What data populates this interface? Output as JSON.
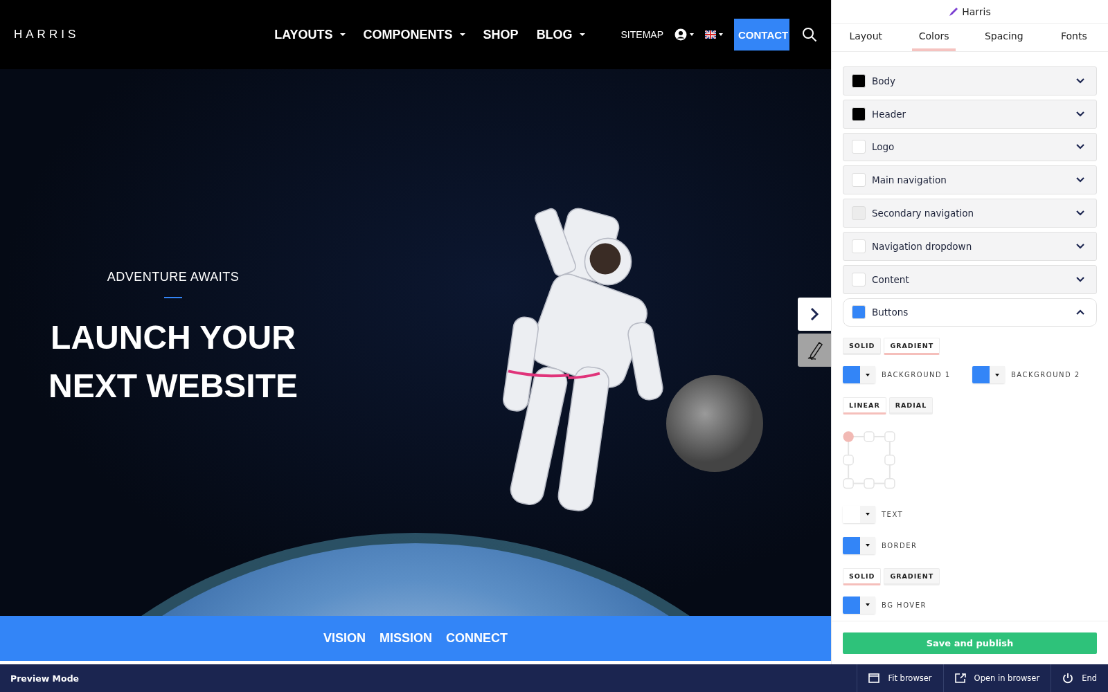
{
  "site_header": {
    "logo": "HARRIS",
    "nav": [
      {
        "label": "LAYOUTS",
        "dropdown": true
      },
      {
        "label": "COMPONENTS",
        "dropdown": true
      },
      {
        "label": "SHOP",
        "dropdown": false
      },
      {
        "label": "BLOG",
        "dropdown": true
      }
    ],
    "sitemap": "SITEMAP",
    "contact": "CONTACT"
  },
  "hero": {
    "eyebrow": "ADVENTURE AWAITS",
    "title_lines": [
      "LAUNCH YOUR",
      "NEXT WEBSITE"
    ]
  },
  "sub_nav": [
    "VISION",
    "MISSION",
    "CONNECT"
  ],
  "panel": {
    "title": "Harris",
    "tabs": [
      {
        "label": "Layout",
        "selected": false
      },
      {
        "label": "Colors",
        "selected": true
      },
      {
        "label": "Spacing",
        "selected": false
      },
      {
        "label": "Fonts",
        "selected": false
      }
    ],
    "sections": [
      {
        "label": "Body",
        "color": "#000000",
        "expanded": false
      },
      {
        "label": "Header",
        "color": "#000000",
        "expanded": false
      },
      {
        "label": "Logo",
        "color": "#ffffff",
        "expanded": false
      },
      {
        "label": "Main navigation",
        "color": "#ffffff",
        "expanded": false
      },
      {
        "label": "Secondary navigation",
        "color": "#ececec",
        "expanded": false
      },
      {
        "label": "Navigation dropdown",
        "color": "#ffffff",
        "expanded": false
      },
      {
        "label": "Content",
        "color": "#ffffff",
        "expanded": false
      },
      {
        "label": "Buttons",
        "color": "#3385f7",
        "expanded": true
      }
    ],
    "controls": [
      {
        "kind": "toggle",
        "options": [
          {
            "label": "SOLID",
            "selected": false
          },
          {
            "label": "GRADIENT",
            "selected": true
          }
        ]
      },
      {
        "kind": "colors",
        "swatches": [
          {
            "label": "BACKGROUND 1",
            "color": "#3385f7"
          },
          {
            "label": "BACKGROUND 2",
            "color": "#3385f7"
          }
        ]
      },
      {
        "kind": "toggle",
        "options": [
          {
            "label": "LINEAR",
            "selected": true
          },
          {
            "label": "RADIAL",
            "selected": false
          }
        ]
      },
      {
        "kind": "position",
        "handles": [
          {
            "selected": true
          },
          {
            "selected": false
          },
          {
            "selected": false
          },
          {
            "selected": false
          },
          {
            "selected": false
          },
          {
            "selected": false
          },
          {
            "selected": false
          },
          {
            "selected": false
          }
        ]
      },
      {
        "kind": "colors",
        "swatches": [
          {
            "label": "TEXT",
            "color": "#ffffff"
          }
        ]
      },
      {
        "kind": "colors",
        "swatches": [
          {
            "label": "BORDER",
            "color": "#3385f7"
          }
        ]
      },
      {
        "kind": "toggle",
        "options": [
          {
            "label": "SOLID",
            "selected": true
          },
          {
            "label": "GRADIENT",
            "selected": false
          }
        ]
      },
      {
        "kind": "colors",
        "swatches": [
          {
            "label": "BG HOVER",
            "color": "#3385f7"
          }
        ]
      }
    ],
    "save": "Save and publish"
  },
  "bottom_bar": {
    "mode": "Preview Mode",
    "actions": [
      {
        "kind": "fit",
        "label": "Fit browser"
      },
      {
        "kind": "open",
        "label": "Open in browser"
      },
      {
        "kind": "end",
        "label": "End"
      }
    ]
  }
}
